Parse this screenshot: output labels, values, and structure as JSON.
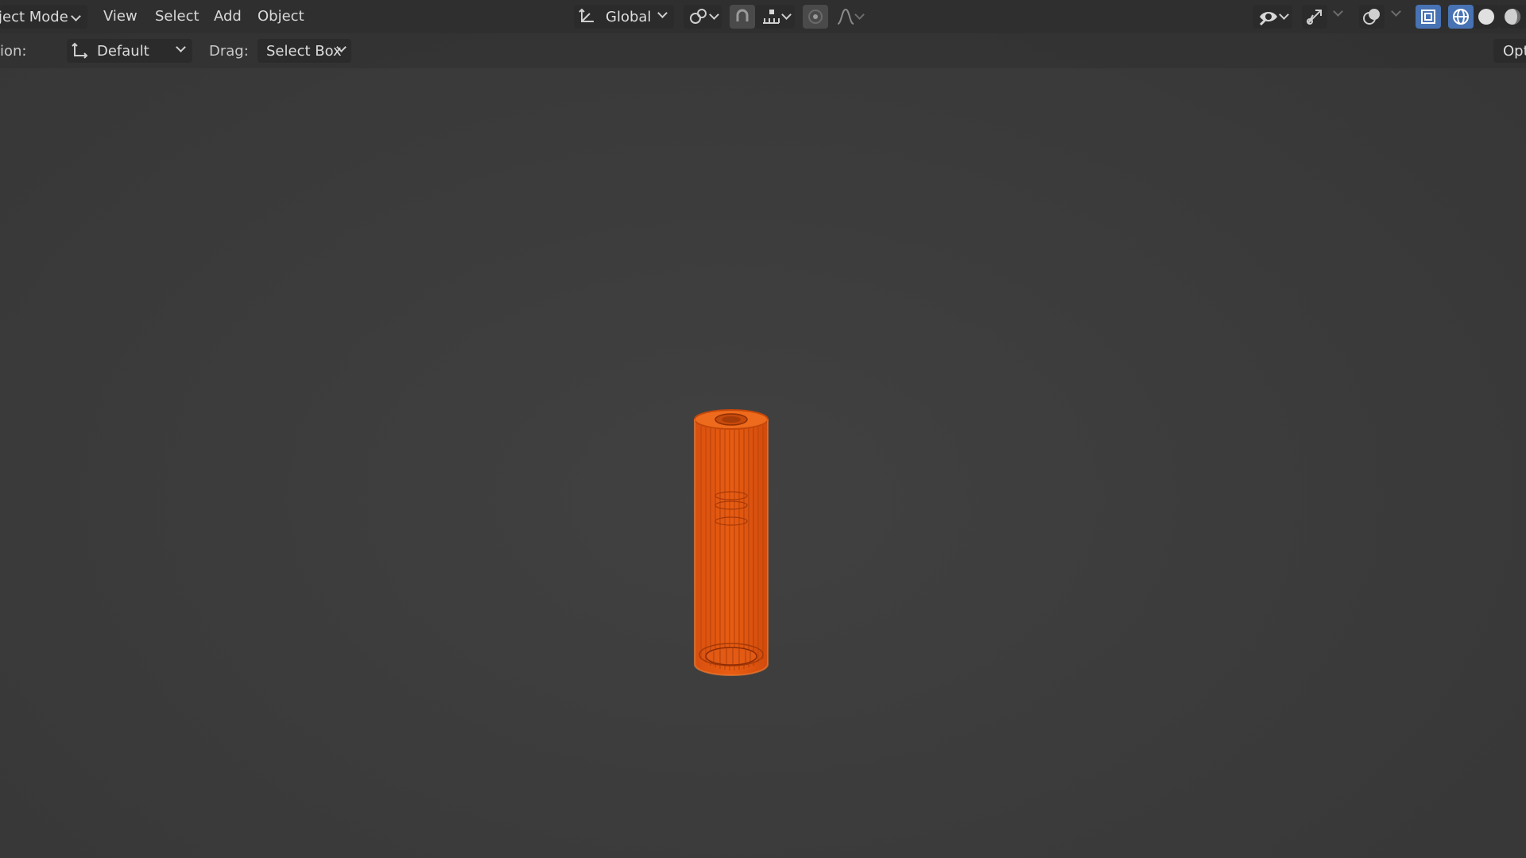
{
  "header": {
    "mode_label": "ject Mode",
    "menus": [
      "View",
      "Select",
      "Add",
      "Object"
    ],
    "transform_orientation": "Global"
  },
  "tool_settings": {
    "orientation_label": "ion:",
    "orientation_value": "Default",
    "drag_label": "Drag:",
    "drag_value": "Select Box",
    "options_label": "Opt"
  },
  "icons": {
    "orientation": "transform-orientation-icon",
    "pivot": "pivot-point-icon",
    "snap": "snap-magnet-icon",
    "snap_target": "snap-increment-icon",
    "proportional": "proportional-edit-icon",
    "falloff": "falloff-curve-icon",
    "visibility": "eye-visibility-icon",
    "gizmo": "gizmo-icon",
    "overlay": "overlay-icon",
    "xray": "xray-icon",
    "wireframe": "wireframe-shading-icon",
    "solid": "solid-shading-icon",
    "material": "material-preview-icon"
  },
  "colors": {
    "selection_orange": "#e8560f",
    "active_blue": "#4772b3",
    "viewport_bg": "#3d3d3d"
  }
}
